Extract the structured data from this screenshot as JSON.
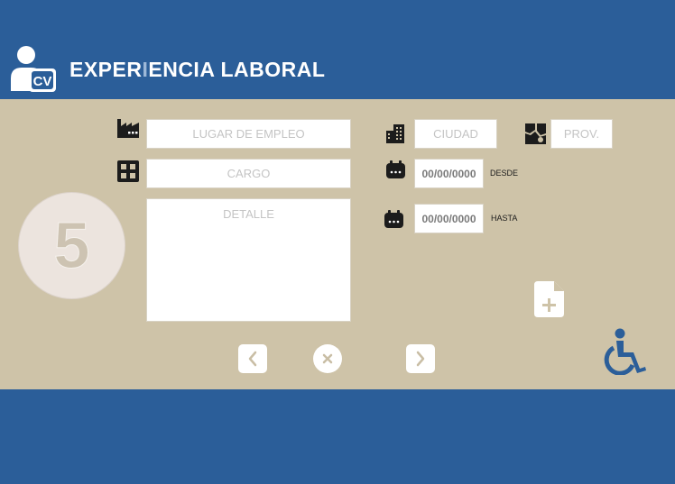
{
  "header": {
    "title_part1": "EXPER",
    "title_accent": "I",
    "title_part2": "ENCIA LABORAL",
    "logo_text": "CV",
    "logo_icon": "user-cv-icon"
  },
  "form": {
    "workplace": {
      "placeholder": "LUGAR DE EMPLEO",
      "value": "",
      "icon": "factory-icon"
    },
    "city": {
      "placeholder": "CIUDAD",
      "value": "",
      "icon": "buildings-icon"
    },
    "province": {
      "placeholder": "PROV.",
      "value": "",
      "icon": "map-icon"
    },
    "position": {
      "placeholder": "CARGO",
      "value": "",
      "icon": "grid-icon"
    },
    "detail": {
      "placeholder": "DETALLE",
      "value": ""
    },
    "start_date": {
      "value": "00/00/0000",
      "label": "DESDE",
      "icon": "calendar-icon"
    },
    "end_date": {
      "value": "00/00/0000",
      "label": "HASTA",
      "icon": "calendar-icon"
    }
  },
  "step": {
    "number": "5"
  },
  "actions": {
    "previous_icon": "chevron-left-icon",
    "close_icon": "close-icon",
    "next_icon": "chevron-right-icon",
    "add_document_icon": "add-document-icon",
    "accessibility_icon": "wheelchair-icon"
  },
  "colors": {
    "primary": "#2b5e99",
    "panel": "#cec3a8",
    "icon_dark": "#1c1c1c",
    "white": "#ffffff"
  }
}
